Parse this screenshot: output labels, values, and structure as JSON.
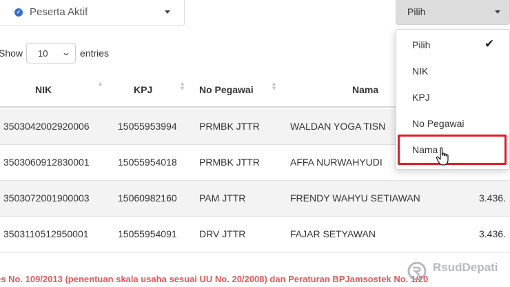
{
  "status_select": {
    "value": "Peserta Aktif"
  },
  "filter_select": {
    "value": "Pilih"
  },
  "show_entries": {
    "show_label": "Show",
    "value": "10",
    "entries_label": "entries"
  },
  "table": {
    "columns": [
      "NIK",
      "KPJ",
      "No Pegawai",
      "Nama"
    ],
    "rows": [
      {
        "nik": "3503042002920006",
        "kpj": "15055953994",
        "no_pegawai": "PRMBK JTTR",
        "nama": "WALDAN YOGA TISN",
        "extra": ""
      },
      {
        "nik": "3503060912830001",
        "kpj": "15055954018",
        "no_pegawai": "PRMBK JTTR",
        "nama": "AFFA NURWAHYUDI",
        "extra": ""
      },
      {
        "nik": "3503072001900003",
        "kpj": "15060982160",
        "no_pegawai": "PAM JTTR",
        "nama": "FRENDY WAHYU SETIAWAN",
        "extra": "3.436."
      },
      {
        "nik": "3503110512950001",
        "kpj": "15055954091",
        "no_pegawai": "DRV JTTR",
        "nama": "FAJAR SETYAWAN",
        "extra": "3.436."
      }
    ]
  },
  "dropdown": {
    "options": [
      "Pilih",
      "NIK",
      "KPJ",
      "No Pegawai",
      "Nama"
    ],
    "selected": "Pilih",
    "hovered": "Nama"
  },
  "footnote": "es No. 109/2013 (penentuan skala usaha sesuai UU No. 20/2008) dan Peraturan BPJamsostek No. 1/20",
  "watermark": {
    "text": "RsudDepati"
  },
  "colors": {
    "highlight": "#e31b23",
    "footnote": "#e05a5a",
    "status_dot": "#2f6fd6"
  }
}
